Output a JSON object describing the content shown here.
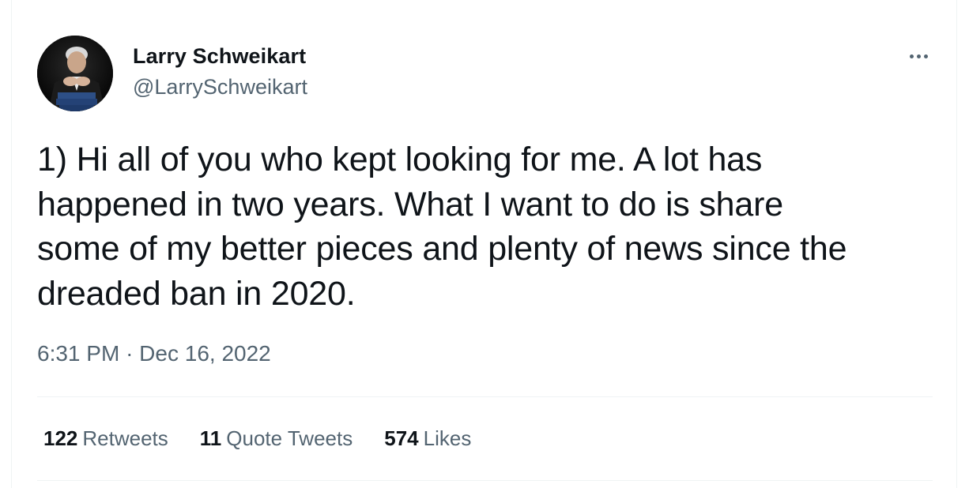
{
  "tweet": {
    "author_name": "Larry Schweikart",
    "author_handle": "@LarrySchweikart",
    "text": "1) Hi all of you who kept looking for me. A lot has\nhappened in two years. What I want to do is share\nsome of my better pieces and plenty of news since the\ndreaded ban in 2020.",
    "time": "6:31 PM",
    "separator": "·",
    "date": "Dec 16, 2022"
  },
  "stats": {
    "retweets_count": "122",
    "retweets_label": "Retweets",
    "quotes_count": "11",
    "quotes_label": "Quote Tweets",
    "likes_count": "574",
    "likes_label": "Likes"
  },
  "icons": {
    "more": "more-horizontal-icon"
  },
  "colors": {
    "text_primary": "#0f1419",
    "text_secondary": "#536471",
    "divider": "#eff3f4"
  }
}
